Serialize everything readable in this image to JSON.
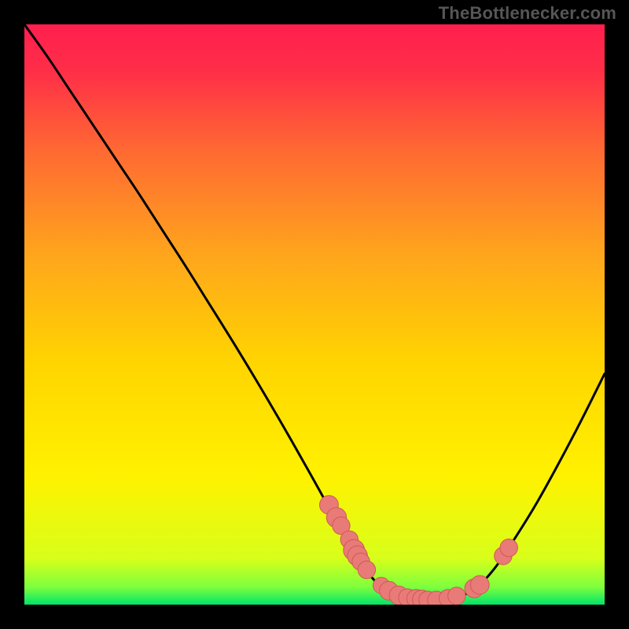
{
  "attribution": "TheBottlenecker.com",
  "colors": {
    "frame": "#000000",
    "gradient_top": "#ff1f4e",
    "gradient_mid": "#ffd400",
    "gradient_bottom": "#00e46a",
    "curve": "#000000",
    "marker_fill": "#e87b77",
    "marker_stroke": "#cf5955"
  },
  "chart_data": {
    "type": "line",
    "title": "",
    "xlabel": "",
    "ylabel": "",
    "xlim": [
      0,
      100
    ],
    "ylim": [
      0,
      100
    ],
    "curve": [
      {
        "x": 0.0,
        "y": 100.0
      },
      {
        "x": 4.0,
        "y": 94.4
      },
      {
        "x": 8.0,
        "y": 88.4
      },
      {
        "x": 12.0,
        "y": 82.4
      },
      {
        "x": 16.0,
        "y": 76.4
      },
      {
        "x": 20.0,
        "y": 70.4
      },
      {
        "x": 24.0,
        "y": 64.2
      },
      {
        "x": 28.0,
        "y": 58.0
      },
      {
        "x": 32.0,
        "y": 51.6
      },
      {
        "x": 36.0,
        "y": 45.2
      },
      {
        "x": 40.0,
        "y": 38.6
      },
      {
        "x": 44.0,
        "y": 31.8
      },
      {
        "x": 48.0,
        "y": 24.8
      },
      {
        "x": 52.0,
        "y": 17.6
      },
      {
        "x": 55.0,
        "y": 12.0
      },
      {
        "x": 58.0,
        "y": 7.2
      },
      {
        "x": 60.5,
        "y": 4.0
      },
      {
        "x": 63.0,
        "y": 2.0
      },
      {
        "x": 66.0,
        "y": 1.0
      },
      {
        "x": 69.0,
        "y": 0.6
      },
      {
        "x": 72.0,
        "y": 0.8
      },
      {
        "x": 75.0,
        "y": 1.4
      },
      {
        "x": 78.0,
        "y": 3.0
      },
      {
        "x": 81.0,
        "y": 6.2
      },
      {
        "x": 84.0,
        "y": 10.6
      },
      {
        "x": 88.0,
        "y": 17.0
      },
      {
        "x": 92.0,
        "y": 24.2
      },
      {
        "x": 96.0,
        "y": 31.8
      },
      {
        "x": 100.0,
        "y": 39.8
      }
    ],
    "markers": [
      {
        "x": 52.5,
        "y": 17.2,
        "r": 1.1
      },
      {
        "x": 53.8,
        "y": 15.0,
        "r": 1.2
      },
      {
        "x": 54.6,
        "y": 13.6,
        "r": 1.0
      },
      {
        "x": 56.0,
        "y": 11.2,
        "r": 1.0
      },
      {
        "x": 56.8,
        "y": 9.4,
        "r": 1.3
      },
      {
        "x": 57.4,
        "y": 8.4,
        "r": 1.2
      },
      {
        "x": 58.0,
        "y": 7.4,
        "r": 1.0
      },
      {
        "x": 59.0,
        "y": 6.0,
        "r": 1.0
      },
      {
        "x": 61.5,
        "y": 3.3,
        "r": 0.9
      },
      {
        "x": 62.8,
        "y": 2.4,
        "r": 1.1
      },
      {
        "x": 64.5,
        "y": 1.6,
        "r": 1.1
      },
      {
        "x": 66.0,
        "y": 1.2,
        "r": 1.0
      },
      {
        "x": 67.5,
        "y": 1.0,
        "r": 1.1
      },
      {
        "x": 68.5,
        "y": 0.9,
        "r": 1.1
      },
      {
        "x": 69.5,
        "y": 0.8,
        "r": 1.0
      },
      {
        "x": 71.0,
        "y": 0.8,
        "r": 1.0
      },
      {
        "x": 73.0,
        "y": 1.1,
        "r": 1.0
      },
      {
        "x": 74.5,
        "y": 1.5,
        "r": 1.0
      },
      {
        "x": 77.5,
        "y": 2.8,
        "r": 1.1
      },
      {
        "x": 78.5,
        "y": 3.4,
        "r": 1.1
      },
      {
        "x": 82.5,
        "y": 8.4,
        "r": 1.0
      },
      {
        "x": 83.5,
        "y": 9.8,
        "r": 1.0
      }
    ]
  }
}
